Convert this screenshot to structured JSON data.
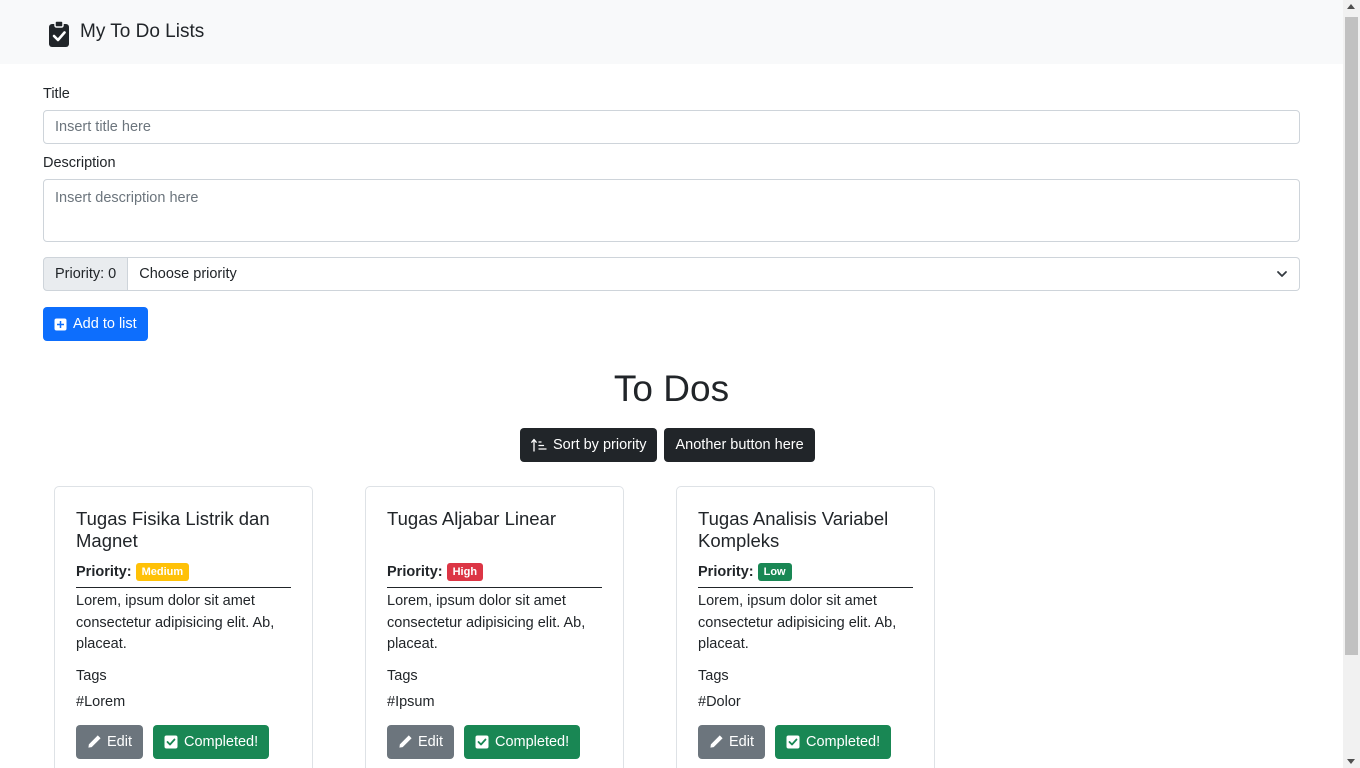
{
  "navbar": {
    "title": "My To Do Lists",
    "icon": "clipboard-check-icon"
  },
  "form": {
    "title_label": "Title",
    "title_placeholder": "Insert title here",
    "description_label": "Description",
    "description_placeholder": "Insert description here",
    "priority_addon": "Priority: 0",
    "priority_select": "Choose priority",
    "add_button": "Add to list"
  },
  "heading": "To Dos",
  "toolbar": {
    "sort_button": "Sort by priority",
    "another_button": "Another button here"
  },
  "colors": {
    "primary": "#0d6efd",
    "dark": "#212529",
    "success": "#198754",
    "secondary": "#6c757d",
    "warning": "#ffc107",
    "danger": "#dc3545"
  },
  "cards": [
    {
      "title": "Tugas Fisika Listrik dan Magnet",
      "priority_label": "Priority:",
      "priority": "Medium",
      "description": "Lorem, ipsum dolor sit amet consectetur adipisicing elit. Ab, placeat.",
      "tags_label": "Tags",
      "tag": "#Lorem",
      "edit": "Edit",
      "completed": "Completed!"
    },
    {
      "title": "Tugas Aljabar Linear",
      "priority_label": "Priority:",
      "priority": "High",
      "description": "Lorem, ipsum dolor sit amet consectetur adipisicing elit. Ab, placeat.",
      "tags_label": "Tags",
      "tag": "#Ipsum",
      "edit": "Edit",
      "completed": "Completed!"
    },
    {
      "title": "Tugas Analisis Variabel Kompleks",
      "priority_label": "Priority:",
      "priority": "Low",
      "description": "Lorem, ipsum dolor sit amet consectetur adipisicing elit. Ab, placeat.",
      "tags_label": "Tags",
      "tag": "#Dolor",
      "edit": "Edit",
      "completed": "Completed!"
    }
  ]
}
